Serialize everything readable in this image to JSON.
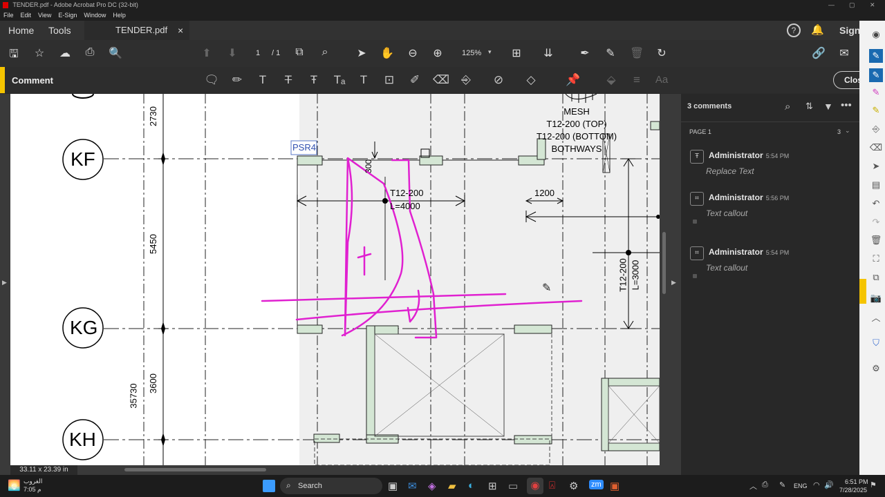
{
  "window": {
    "title": "TENDER.pdf - Adobe Acrobat Pro DC (32-bit)"
  },
  "menu": [
    "File",
    "Edit",
    "View",
    "E-Sign",
    "Window",
    "Help"
  ],
  "tabs": {
    "home": "Home",
    "tools": "Tools",
    "document": "TENDER.pdf",
    "close_glyph": "×"
  },
  "account": {
    "signin": "Sign In"
  },
  "toolbar": {
    "page_current": "1",
    "page_total": "/ 1",
    "zoom": "125%"
  },
  "comment_bar": {
    "title": "Comment",
    "close": "Close"
  },
  "drawing": {
    "grid_rows": [
      "KF",
      "KG",
      "KH"
    ],
    "dims_left": [
      "2730",
      "5450",
      "3600",
      "35730"
    ],
    "tag": "PSR4",
    "note_mesh": [
      "MESH",
      "T12-200 (TOP)",
      "T12-200 (BOTTOM)",
      "BOTHWAYS"
    ],
    "bar1": [
      "T12-200",
      "L=4000"
    ],
    "dim_1200": "1200",
    "bar2": [
      "T12-200",
      "L=3000"
    ],
    "dim_300": "300"
  },
  "status": {
    "page_size": "33.11 x 23.39 in"
  },
  "panel": {
    "count": "3 comments",
    "page_label": "PAGE 1",
    "page_count": "3",
    "comments": [
      {
        "author": "Administrator",
        "time": "5:54 PM",
        "text": "Replace Text"
      },
      {
        "author": "Administrator",
        "time": "5:56 PM",
        "text": "Text callout"
      },
      {
        "author": "Administrator",
        "time": "5:54 PM",
        "text": "Text callout"
      }
    ]
  },
  "taskbar": {
    "weather_line1": "الغروب",
    "weather_line2": "م 7:05",
    "search": "Search",
    "lang": "ENG",
    "time": "6:51 PM",
    "date": "7/28/2025"
  },
  "colors": {
    "accent": "#f5c400",
    "markup": "#e020d0",
    "panel": "#282828"
  }
}
